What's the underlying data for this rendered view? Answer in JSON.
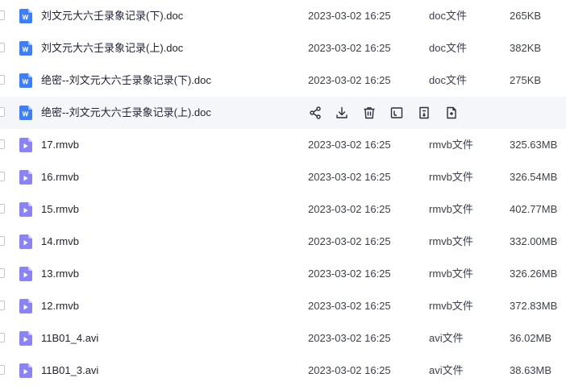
{
  "files": [
    {
      "name": "刘文元大六壬录象记录(下).doc",
      "date": "2023-03-02 16:25",
      "type": "doc文件",
      "size": "265KB",
      "icon": "word-doc-icon"
    },
    {
      "name": "刘文元大六壬录象记录(上).doc",
      "date": "2023-03-02 16:25",
      "type": "doc文件",
      "size": "382KB",
      "icon": "word-doc-icon"
    },
    {
      "name": "绝密--刘文元大六壬录象记录(下).doc",
      "date": "2023-03-02 16:25",
      "type": "doc文件",
      "size": "275KB",
      "icon": "word-doc-icon"
    },
    {
      "name": "绝密--刘文元大六壬录象记录(上).doc",
      "date": "",
      "type": "",
      "size": "",
      "icon": "word-doc-icon",
      "hovered": true
    },
    {
      "name": "17.rmvb",
      "date": "2023-03-02 16:25",
      "type": "rmvb文件",
      "size": "325.63MB",
      "icon": "video-file-icon"
    },
    {
      "name": "16.rmvb",
      "date": "2023-03-02 16:25",
      "type": "rmvb文件",
      "size": "326.54MB",
      "icon": "video-file-icon"
    },
    {
      "name": "15.rmvb",
      "date": "2023-03-02 16:25",
      "type": "rmvb文件",
      "size": "402.77MB",
      "icon": "video-file-icon"
    },
    {
      "name": "14.rmvb",
      "date": "2023-03-02 16:25",
      "type": "rmvb文件",
      "size": "332.00MB",
      "icon": "video-file-icon"
    },
    {
      "name": "13.rmvb",
      "date": "2023-03-02 16:25",
      "type": "rmvb文件",
      "size": "326.26MB",
      "icon": "video-file-icon"
    },
    {
      "name": "12.rmvb",
      "date": "2023-03-02 16:25",
      "type": "rmvb文件",
      "size": "372.83MB",
      "icon": "video-file-icon"
    },
    {
      "name": "11B01_4.avi",
      "date": "2023-03-02 16:25",
      "type": "avi文件",
      "size": "36.02MB",
      "icon": "video-file-icon"
    },
    {
      "name": "11B01_3.avi",
      "date": "2023-03-02 16:25",
      "type": "avi文件",
      "size": "38.63MB",
      "icon": "video-file-icon"
    }
  ],
  "row_actions": [
    {
      "icon": "share-icon"
    },
    {
      "icon": "download-icon"
    },
    {
      "icon": "delete-icon"
    },
    {
      "icon": "rename-icon"
    },
    {
      "icon": "move-icon"
    },
    {
      "icon": "copy-icon"
    }
  ],
  "colors": {
    "word_icon": "#3f7ff5",
    "video_icon": "#8b83f0",
    "hover_row": "#f5f6fa"
  }
}
